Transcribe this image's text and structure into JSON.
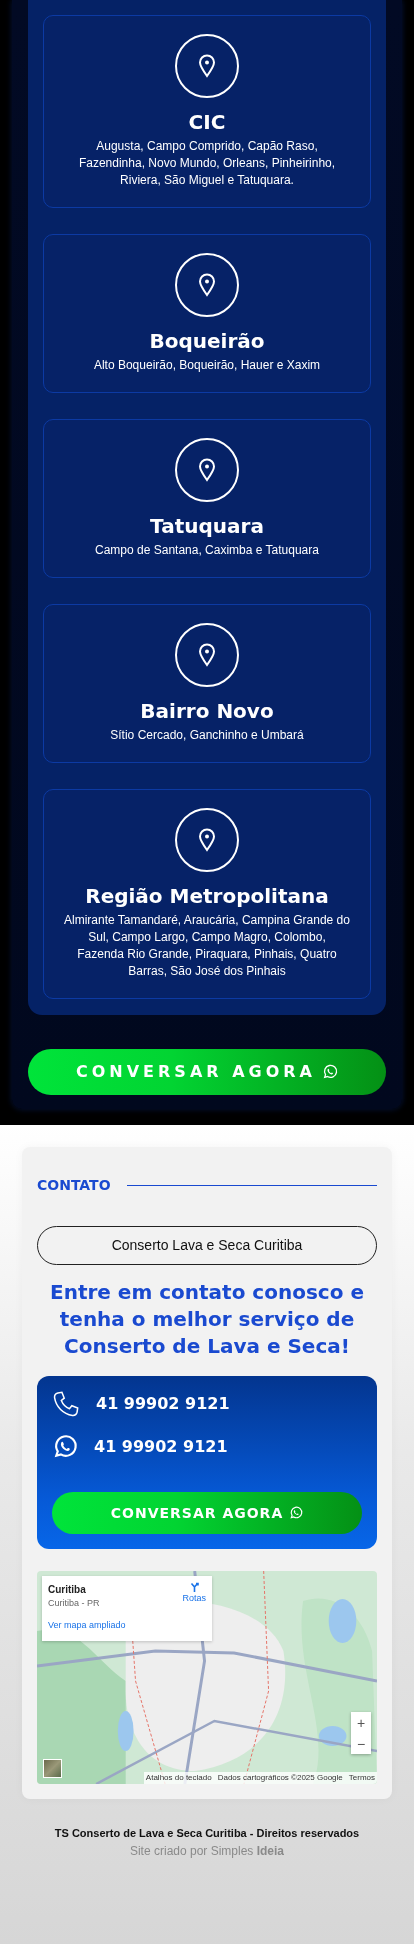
{
  "service_areas": [
    {
      "title": "CIC",
      "description": "Augusta, Campo Comprido, Capão Raso, Fazendinha, Novo Mundo, Orleans, Pinheirinho, Riviera, São Miguel e Tatuquara."
    },
    {
      "title": "Boqueirão",
      "description": "Alto Boqueirão, Boqueirão, Hauer e Xaxim"
    },
    {
      "title": "Tatuquara",
      "description": "Campo de Santana, Caximba e Tatuquara"
    },
    {
      "title": "Bairro Novo",
      "description": "Sítio Cercado, Ganchinho e Umbará"
    },
    {
      "title": "Região Metropolitana",
      "description": "Almirante Tamandaré, Araucária, Campina Grande do Sul, Campo Largo, Campo Magro, Colombo, Fazenda Rio Grande, Piraquara, Pinhais, Quatro Barras, São José dos Pinhais"
    }
  ],
  "cta_button": {
    "label": "CONVERSAR AGORA"
  },
  "contact": {
    "section_label": "CONTATO",
    "business_name": "Conserto Lava e Seca Curitiba",
    "headline": "Entre em contato conosco e tenha o melhor serviço de Conserto de Lava e Seca!",
    "phones": [
      {
        "kind": "phone",
        "number": "41 99902 9121"
      },
      {
        "kind": "whatsapp",
        "number": "41 99902 9121"
      }
    ],
    "button": {
      "label": "CONVERSAR AGORA"
    },
    "map": {
      "place_name": "Curitiba",
      "place_region": "Curitiba - PR",
      "directions_label": "Rotas",
      "larger_map_link": "Ver mapa ampliado",
      "zoom_in": "+",
      "zoom_out": "−",
      "attribution": [
        "Atalhos do teclado",
        "Dados cartográficos ©2025 Google",
        "Termos"
      ]
    }
  },
  "footer": {
    "copyright": "TS Conserto de Lava e Seca Curitiba - Direitos reservados",
    "credit": "Site criado por Simples **Ideia**"
  }
}
